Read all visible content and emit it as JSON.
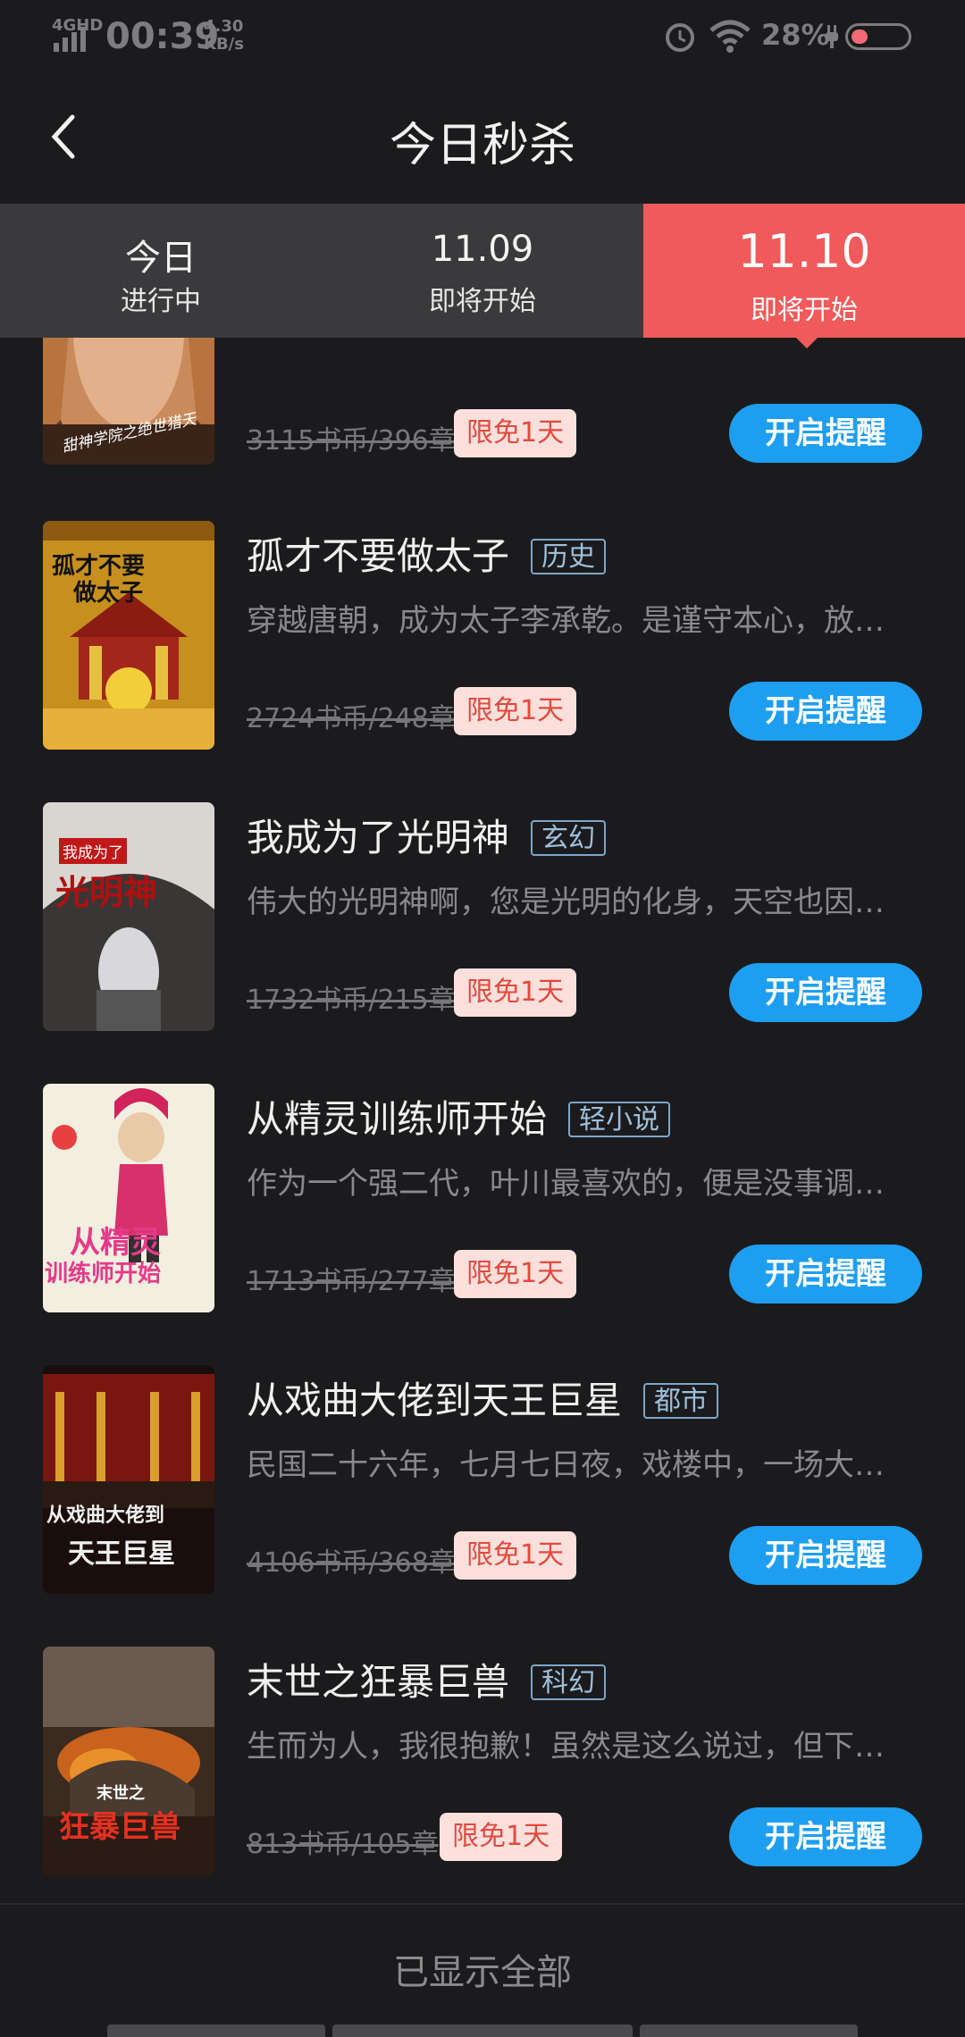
{
  "status_bar": {
    "network": "4GHD",
    "time": "00:39",
    "speed": "4.30 KB/s",
    "battery": "28%"
  },
  "header": {
    "title": "今日秒杀"
  },
  "tabs": [
    {
      "label": "今日",
      "status": "进行中"
    },
    {
      "label": "11.09",
      "status": "即将开始"
    },
    {
      "label": "11.10",
      "status": "即将开始",
      "active": true
    }
  ],
  "books": [
    {
      "title": "",
      "tag": "",
      "desc": "",
      "price": "3115书币/396章",
      "badge": "限免1天",
      "button": "开启提醒"
    },
    {
      "title": "孤才不要做太子",
      "tag": "历史",
      "desc": "穿越唐朝，成为太子李承乾。是谨守本心，放…",
      "price": "2724书币/248章",
      "badge": "限免1天",
      "button": "开启提醒"
    },
    {
      "title": "我成为了光明神",
      "tag": "玄幻",
      "desc": "伟大的光明神啊，您是光明的化身，天空也因…",
      "price": "1732书币/215章",
      "badge": "限免1天",
      "button": "开启提醒"
    },
    {
      "title": "从精灵训练师开始",
      "tag": "轻小说",
      "desc": "作为一个强二代，叶川最喜欢的，便是没事调…",
      "price": "1713书币/277章",
      "badge": "限免1天",
      "button": "开启提醒"
    },
    {
      "title": "从戏曲大佬到天王巨星",
      "tag": "都市",
      "desc": "民国二十六年，七月七日夜，戏楼中，一场大…",
      "price": "4106书币/368章",
      "badge": "限免1天",
      "button": "开启提醒"
    },
    {
      "title": "末世之狂暴巨兽",
      "tag": "科幻",
      "desc": "生而为人，我很抱歉！虽然是这么说过，但下…",
      "price": "813书币/105章",
      "badge": "限免1天",
      "button": "开启提醒"
    }
  ],
  "covers": {
    "c0": "甜神学院之绝世猎天",
    "c1a": "孤才不要",
    "c1b": "做太子",
    "c2a": "我成为了",
    "c2b": "光明神",
    "c3a": "从精灵",
    "c3b": "训练师开始",
    "c4a": "从戏曲大佬到",
    "c4b": "天王巨星",
    "c5a": "末世之",
    "c5b": "狂暴巨兽"
  },
  "footer": {
    "text": "已显示全部"
  },
  "colors": {
    "background": "#1b1b1d",
    "tab_active": "#f05a5a",
    "button": "#1e9ef0",
    "badge_bg": "#fde0dc",
    "badge_text": "#e24a3e"
  }
}
